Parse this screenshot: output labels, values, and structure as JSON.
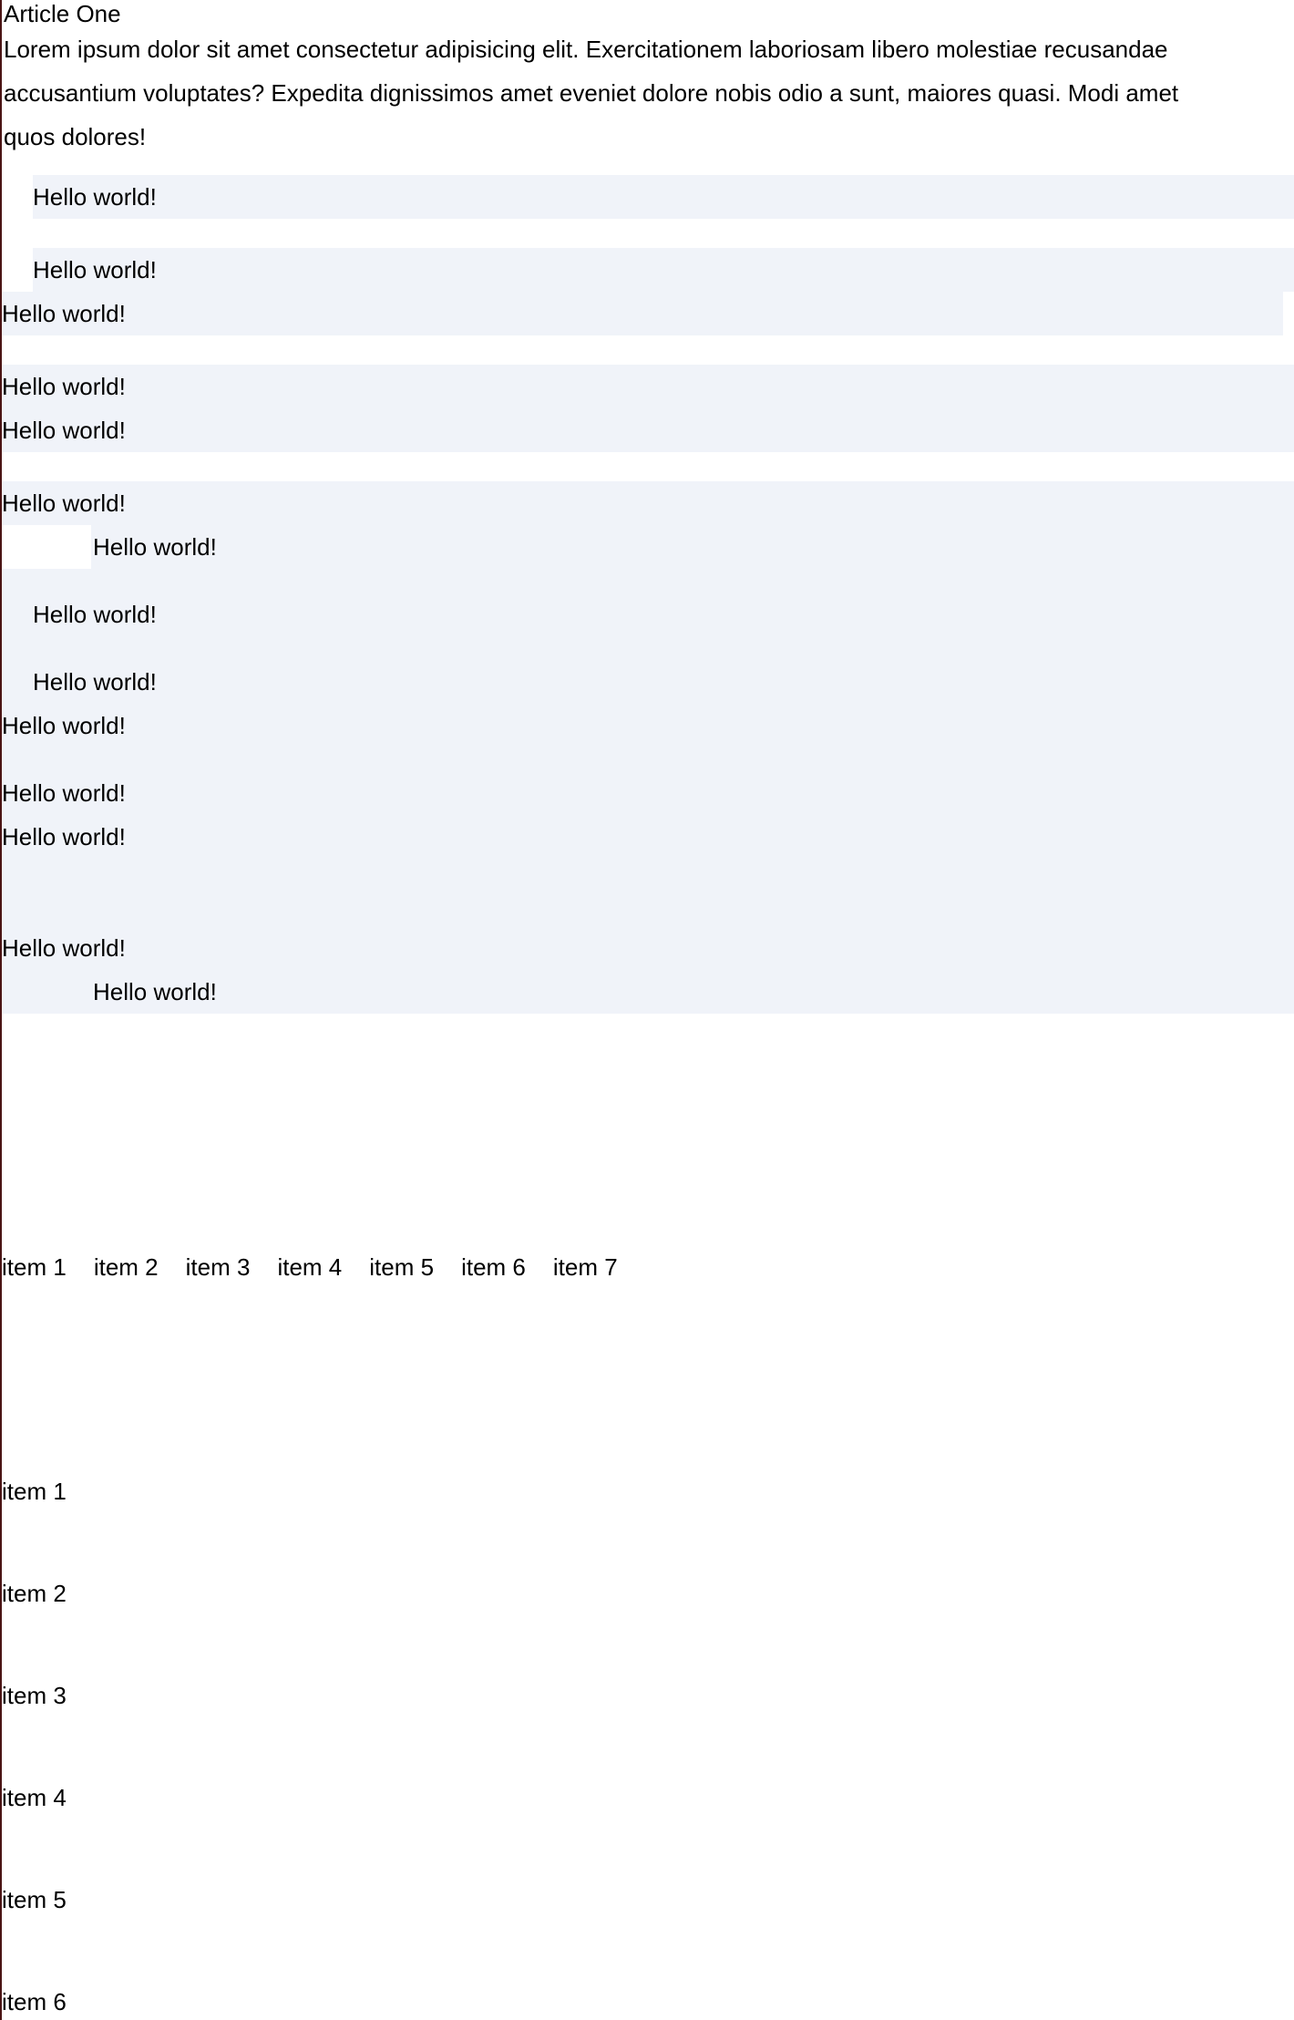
{
  "page": {
    "background_color": "#ffffff",
    "text_color": "#000000",
    "highlight_color": "#f0f3f9",
    "edge_rule_color": "#4a1414"
  },
  "article": {
    "title": "Article One",
    "paragraph": "Lorem ipsum dolor sit amet consectetur adipisicing elit. Exercitationem laboriosam libero molestiae recusandae accusantium voluptates? Expedita dignissimos amet eveniet dolore nobis odio a sunt, maiores quasi. Modi amet quos dolores!"
  },
  "hello_blocks": {
    "label": "Hello world!",
    "group_1": [
      {
        "text": "Hello world!",
        "indent": "indented"
      }
    ],
    "group_2": [
      {
        "text": "Hello world!",
        "indent": "indented"
      },
      {
        "text": "Hello world!",
        "indent": "flush"
      }
    ],
    "group_3": [
      {
        "text": "Hello world!",
        "indent": "flush"
      },
      {
        "text": "Hello world!",
        "indent": "flush"
      }
    ],
    "group_4": [
      {
        "text": "Hello world!",
        "indent": "flush"
      },
      {
        "text": "Hello world!",
        "indent": "deep"
      },
      {
        "text": "Hello world!",
        "indent": "indented"
      },
      {
        "text": "Hello world!",
        "indent": "indented"
      },
      {
        "text": "Hello world!",
        "indent": "flush"
      },
      {
        "text": "Hello world!",
        "indent": "flush"
      },
      {
        "text": "Hello world!",
        "indent": "flush"
      },
      {
        "text": "Hello world!",
        "indent": "flush"
      },
      {
        "text": "Hello world!",
        "indent": "deep"
      }
    ]
  },
  "horizontal_list": {
    "items": [
      "item 1",
      "item 2",
      "item 3",
      "item 4",
      "item 5",
      "item 6",
      "item 7"
    ]
  },
  "vertical_list": {
    "items": [
      "item 1",
      "item 2",
      "item 3",
      "item 4",
      "item 5",
      "item 6"
    ]
  }
}
